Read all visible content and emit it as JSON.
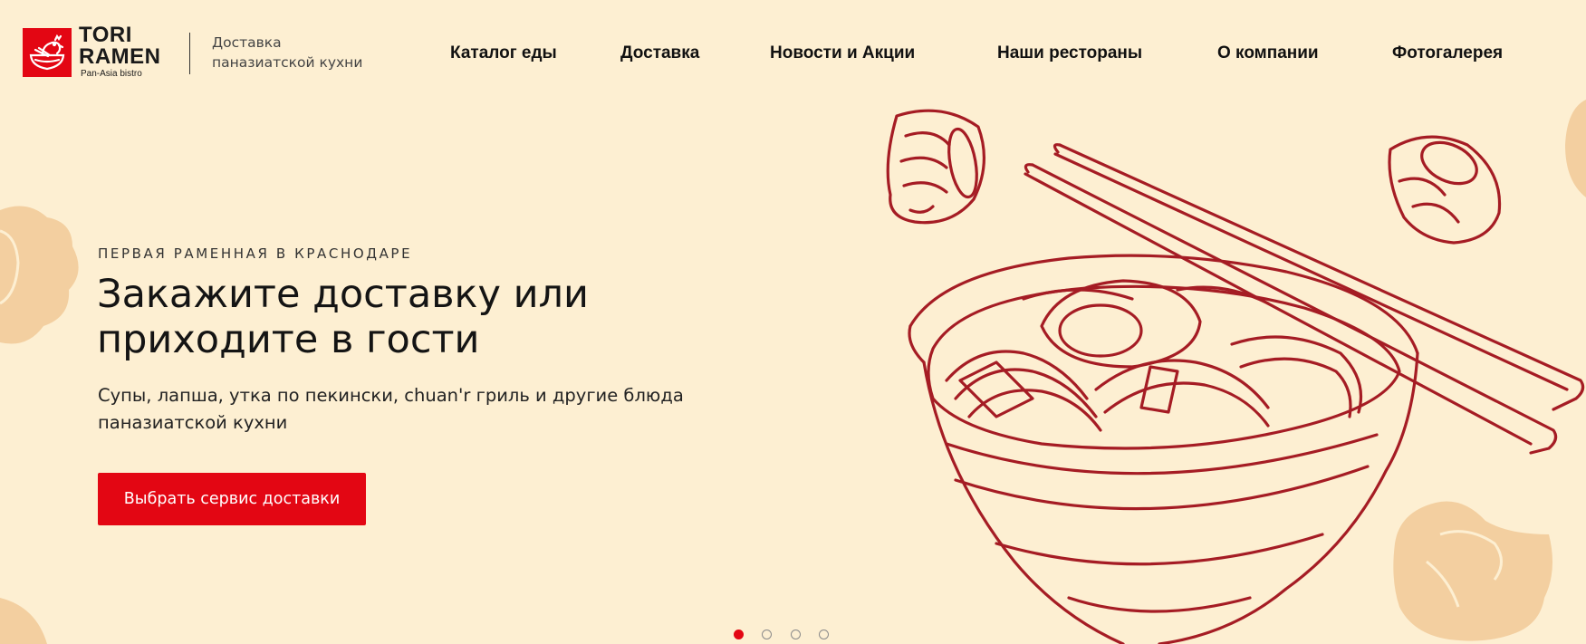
{
  "brand": {
    "name_line1": "TORI",
    "name_line2": "RAMEN",
    "subtitle": "Pan-Asia bistro",
    "tagline_line1": "Доставка",
    "tagline_line2": "паназиатской кухни",
    "accent_color": "#e30613"
  },
  "nav": {
    "items": [
      {
        "label": "Каталог еды"
      },
      {
        "label": "Доставка"
      },
      {
        "label": "Новости и Акции"
      },
      {
        "label": "Наши рестораны"
      },
      {
        "label": "О компании"
      },
      {
        "label": "Фотогалерея"
      }
    ]
  },
  "hero": {
    "kicker": "ПЕРВАЯ РАМЕННАЯ В КРАСНОДАРЕ",
    "title_line1": "Закажите доставку или",
    "title_line2": "приходите в гости",
    "description_line1": "Супы, лапша, утка по пекински, chuan'r гриль и другие блюда",
    "description_line2": "паназиатской кухни",
    "cta_label": "Выбрать сервис доставки"
  },
  "slider": {
    "total": 4,
    "active": 1
  },
  "colors": {
    "background": "#fdefd2",
    "illustration": "#a51c24",
    "decor": "#f3cfa0"
  },
  "icons": [
    "chicken-bowl-logo-icon",
    "ramen-bowl-illustration",
    "sushi-roll-illustration",
    "chopsticks-illustration"
  ]
}
